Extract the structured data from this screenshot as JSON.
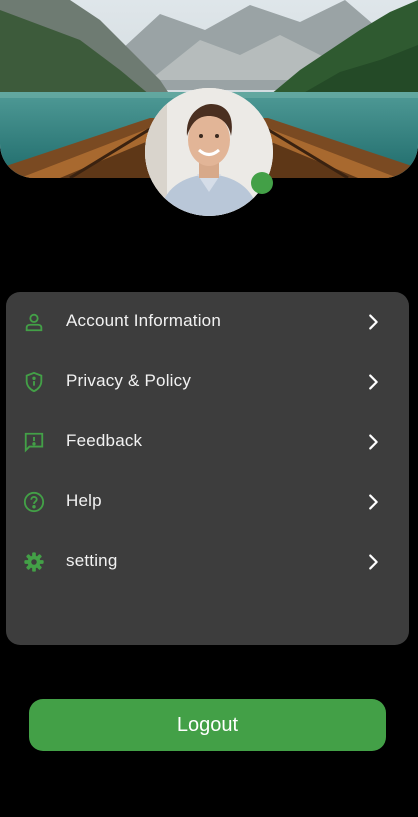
{
  "colors": {
    "accent": "#43a047",
    "card": "#3d3d3d",
    "background": "#000000",
    "text": "#f2f2f2"
  },
  "header": {
    "cover_image": "lake-boat-mountains-photo",
    "avatar": "user-portrait-photo",
    "status": "online"
  },
  "menu": {
    "items": [
      {
        "label": "Account Information",
        "icon": "person-icon"
      },
      {
        "label": "Privacy & Policy",
        "icon": "shield-info-icon"
      },
      {
        "label": "Feedback",
        "icon": "feedback-icon"
      },
      {
        "label": "Help",
        "icon": "help-icon"
      },
      {
        "label": "setting",
        "icon": "gear-icon"
      }
    ]
  },
  "logout": {
    "label": "Logout"
  }
}
